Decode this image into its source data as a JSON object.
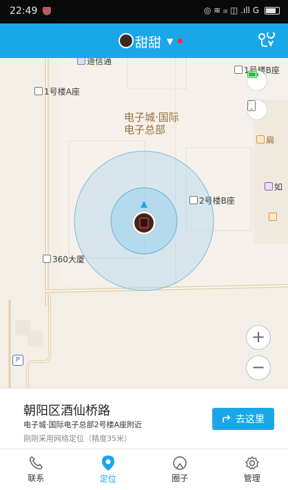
{
  "status_bar": {
    "time": "22:49",
    "indicators": "◎ ≋ ᵢₗₗ ◫ .ıll G"
  },
  "header": {
    "title": "甜甜",
    "caret": "▼"
  },
  "map": {
    "labels": {
      "tongxin": "迪信通",
      "bldg1a": "1号楼A座",
      "bldg1b": "1号楼B座",
      "bldg2b": "2号楼B座",
      "bldg360": "360大厦",
      "poi_line1": "电子城·国际",
      "poi_line2": "电子总部",
      "edge_bian": "扁",
      "edge_ru": "如"
    },
    "zoom_in": "+",
    "zoom_out": "−",
    "parking": "P"
  },
  "info": {
    "address": "朝阳区酒仙桥路",
    "nearby": "电子城·国际电子总部2号楼A座附近",
    "method": "刚刚采用网络定位（精度35米）",
    "goto_label": "去这里"
  },
  "nav": {
    "tabs": [
      {
        "label": "联系"
      },
      {
        "label": "定位"
      },
      {
        "label": "圈子"
      },
      {
        "label": "管理"
      }
    ]
  },
  "colors": {
    "accent": "#1aa7e8",
    "map_bg": "#f3efe7",
    "marker": "#1aa7e8"
  }
}
